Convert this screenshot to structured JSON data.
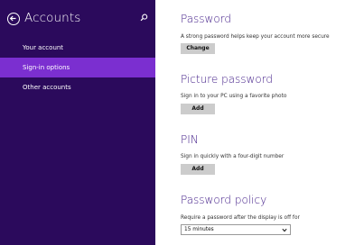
{
  "sidebar": {
    "title": "Accounts",
    "items": [
      {
        "label": "Your account",
        "selected": false
      },
      {
        "label": "Sign-in options",
        "selected": true
      },
      {
        "label": "Other accounts",
        "selected": false
      }
    ]
  },
  "sections": {
    "password": {
      "heading": "Password",
      "description": "A strong password helps keep your account more secure",
      "button_label": "Change"
    },
    "picture_password": {
      "heading": "Picture password",
      "description": "Sign in to your PC using a favorite photo",
      "button_label": "Add"
    },
    "pin": {
      "heading": "PIN",
      "description": "Sign in quickly with a four-digit number",
      "button_label": "Add"
    },
    "password_policy": {
      "heading": "Password policy",
      "description": "Require a password after the display is off for",
      "selected_value": "15 minutes"
    }
  },
  "colors": {
    "sidebar_bg": "#2b0a5c",
    "selected_bg": "#7b2fd0",
    "heading": "#3f1a86",
    "button_bg": "#cccccc"
  },
  "icons": {
    "back": "back-arrow-circle-icon",
    "search": "search-icon",
    "dropdown": "chevron-down-icon"
  }
}
